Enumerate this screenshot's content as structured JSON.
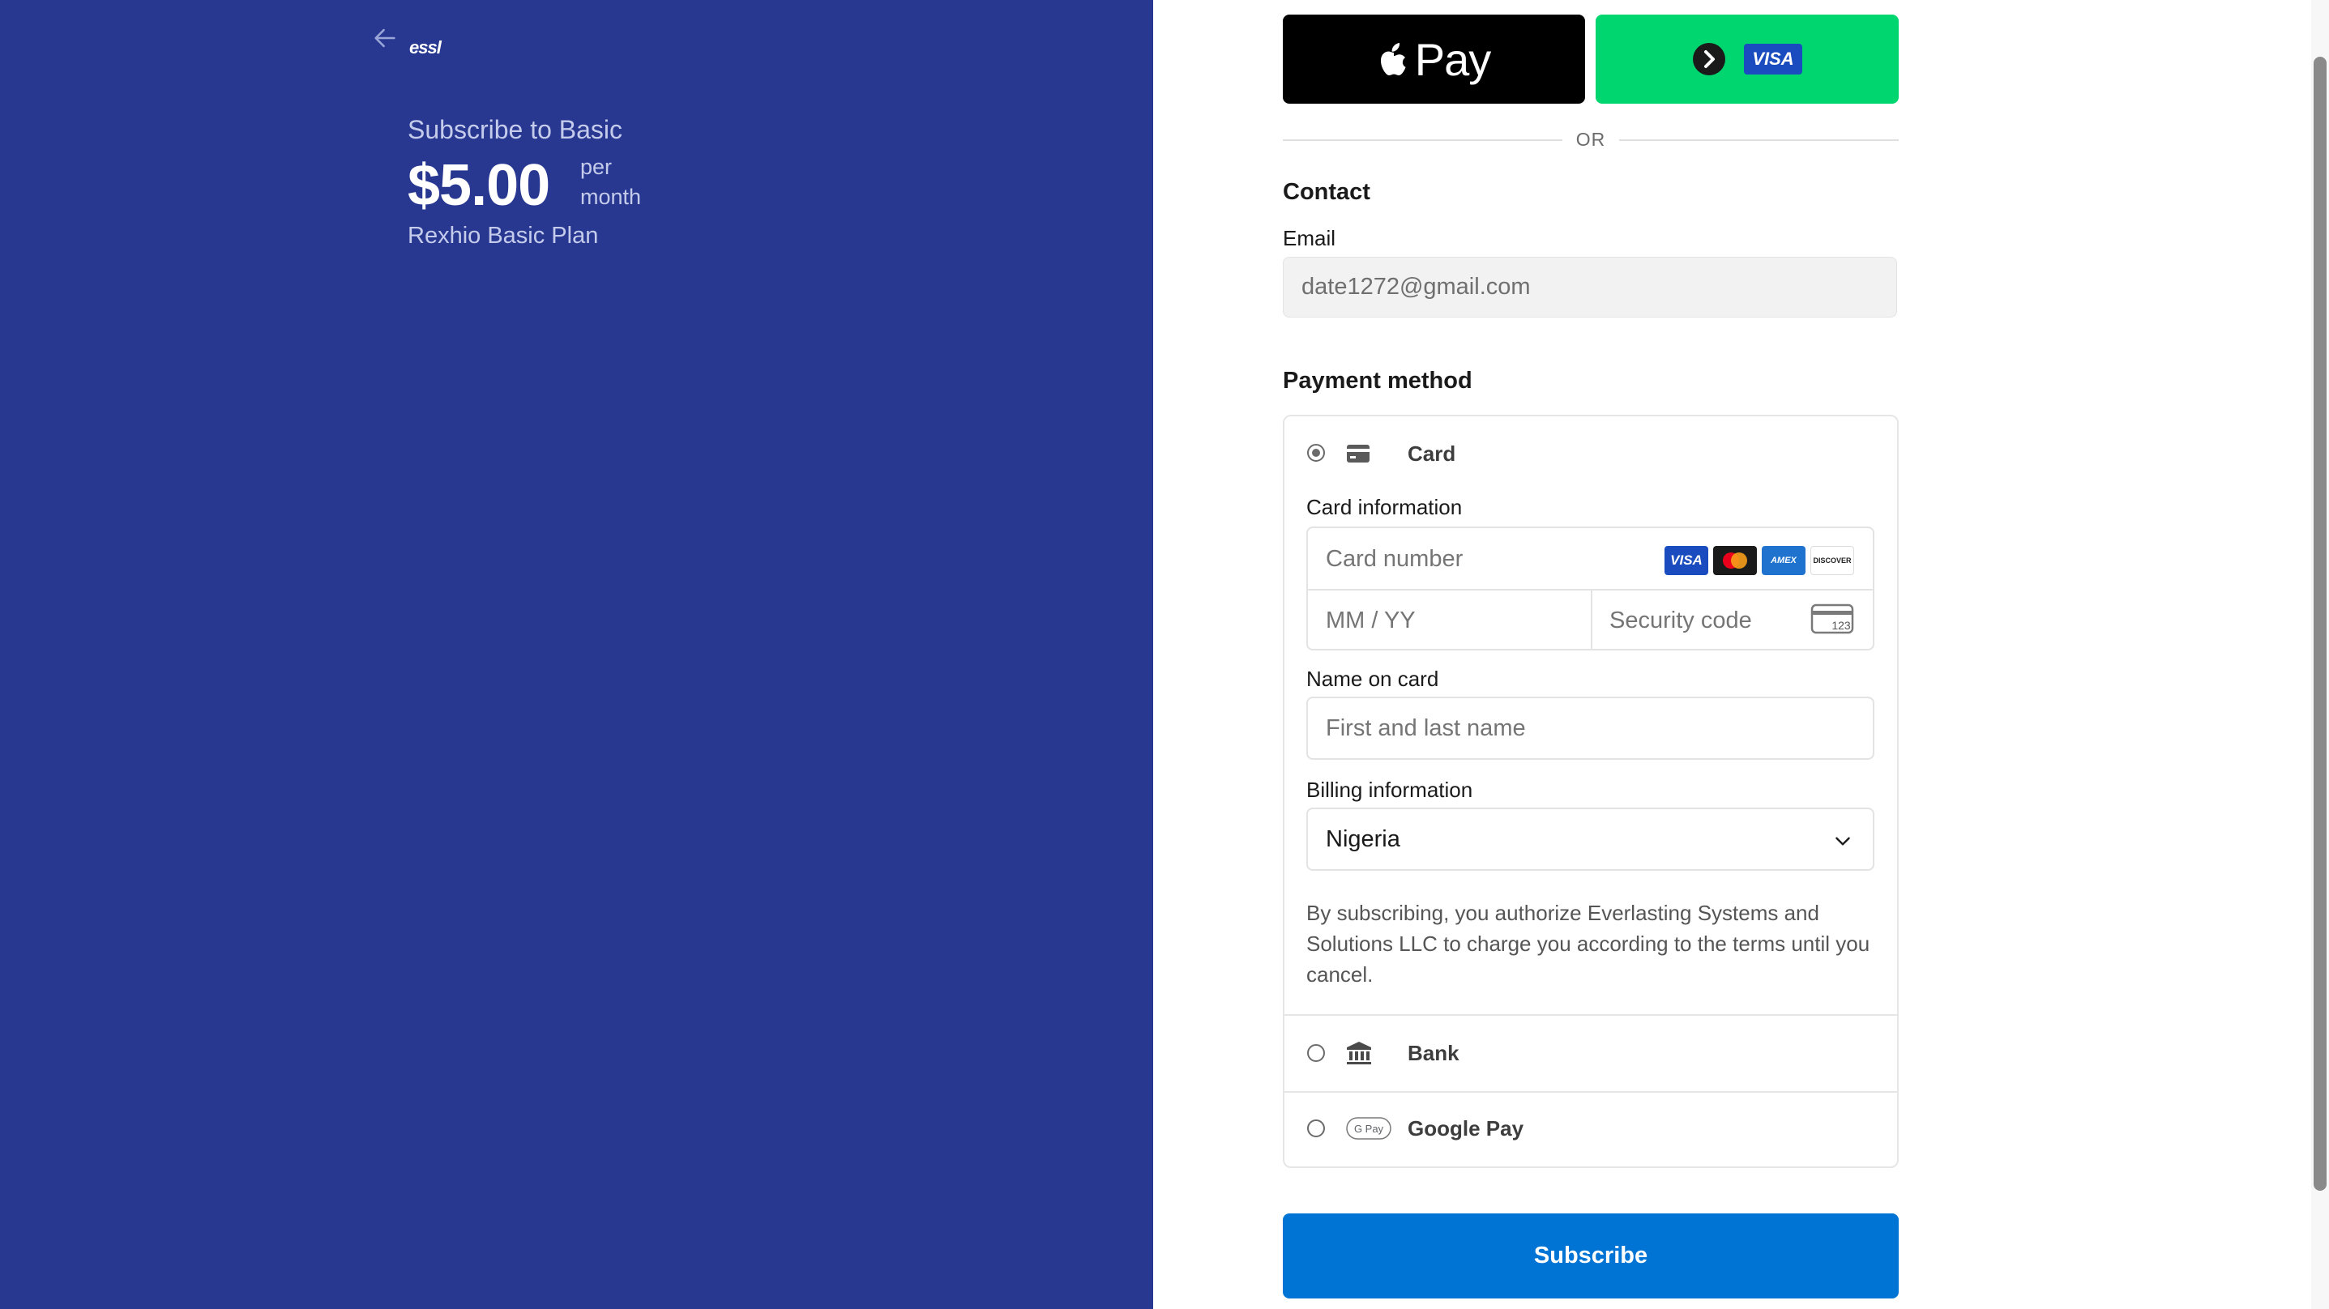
{
  "summary": {
    "brand": "essl",
    "title": "Subscribe to Basic",
    "price": "$5.00",
    "period_line1": "per",
    "period_line2": "month",
    "plan_name": "Rexhio Basic Plan"
  },
  "wallets": {
    "apple_pay_label": "Pay",
    "click_to_pay_brand": "VISA"
  },
  "divider_text": "OR",
  "contact": {
    "heading": "Contact",
    "email_label": "Email",
    "email_value": "date1272@gmail.com"
  },
  "payment": {
    "heading": "Payment method",
    "methods": [
      {
        "label": "Card",
        "selected": true,
        "icon": "credit-card-icon"
      },
      {
        "label": "Bank",
        "selected": false,
        "icon": "bank-icon"
      },
      {
        "label": "Google Pay",
        "selected": false,
        "icon": "google-pay-icon"
      }
    ],
    "card_info_label": "Card information",
    "card_number_placeholder": "Card number",
    "expiry_placeholder": "MM / YY",
    "cvc_placeholder": "Security code",
    "cvc_icon_text": "123",
    "card_brands": [
      "VISA",
      "Mastercard",
      "AMEX",
      "DISCOVER"
    ],
    "name_label": "Name on card",
    "name_placeholder": "First and last name",
    "billing_label": "Billing information",
    "country": "Nigeria",
    "terms": "By subscribing, you authorize Everlasting Systems and Solutions LLC to charge you according to the terms until you cancel."
  },
  "subscribe_label": "Subscribe",
  "colors": {
    "left_panel_bg": "#283891",
    "subscribe_button": "#0074d4",
    "click_to_pay_bg": "#00d66f",
    "apple_pay_bg": "#000000"
  }
}
